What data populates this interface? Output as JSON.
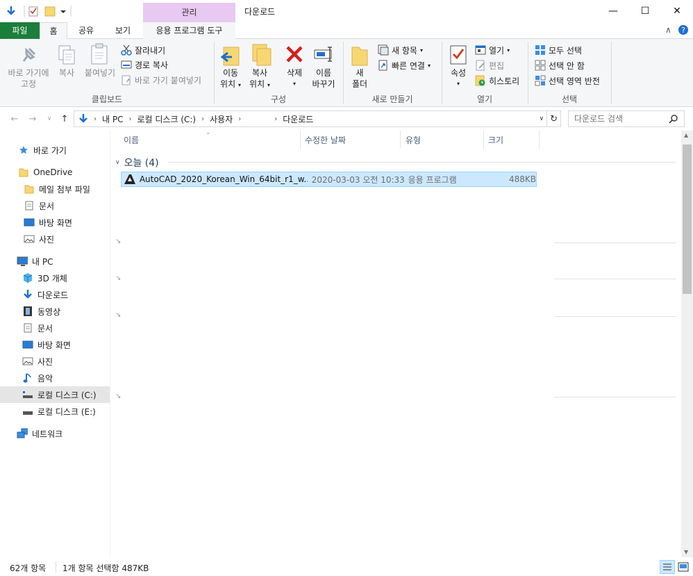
{
  "window": {
    "title": "다운로드",
    "context_tab": "관리",
    "controls": {
      "minimize": "—",
      "maximize": "☐",
      "close": "✕"
    }
  },
  "ribbon_tabs": {
    "file": "파일",
    "home": "홈",
    "share": "공유",
    "view": "보기",
    "app_tools": "응용 프로그램 도구"
  },
  "ribbon": {
    "clipboard": {
      "label": "클립보드",
      "pin_line1": "바로 가기에",
      "pin_line2": "고정",
      "copy": "복사",
      "paste": "붙여넣기",
      "cut": "잘라내기",
      "copy_path": "경로 복사",
      "paste_shortcut": "바로 가기 붙여넣기"
    },
    "organize": {
      "label": "구성",
      "move_line1": "이동",
      "move_line2": "위치",
      "copy_line1": "복사",
      "copy_line2": "위치",
      "delete": "삭제",
      "rename_line1": "이름",
      "rename_line2": "바꾸기"
    },
    "new": {
      "label": "새로 만들기",
      "folder_line1": "새",
      "folder_line2": "폴더",
      "new_item": "새 항목",
      "easy_access": "빠른 연결"
    },
    "open": {
      "label": "열기",
      "properties": "속성",
      "open": "열기",
      "edit": "편집",
      "history": "히스토리"
    },
    "select": {
      "label": "선택",
      "select_all": "모두 선택",
      "select_none": "선택 안 함",
      "invert": "선택 영역 반전"
    }
  },
  "address": {
    "crumbs": [
      "내 PC",
      "로컬 디스크 (C:)",
      "사용자",
      "다운로드"
    ],
    "search_placeholder": "다운로드 검색"
  },
  "nav": {
    "quick_access": "바로 가기",
    "onedrive": "OneDrive",
    "onedrive_items": [
      "메일 첨부 파일",
      "문서",
      "바탕 화면",
      "사진"
    ],
    "this_pc": "내 PC",
    "pc_items": [
      "3D 개체",
      "다운로드",
      "동영상",
      "문서",
      "바탕 화면",
      "사진",
      "음악",
      "로컬 디스크 (C:)",
      "로컬 디스크 (E:)"
    ],
    "network": "네트워크"
  },
  "columns": {
    "name": "이름",
    "modified": "수정한 날짜",
    "type": "유형",
    "size": "크기"
  },
  "groups": {
    "today": "오늘 (4)"
  },
  "files": [
    {
      "name": "AutoCAD_2020_Korean_Win_64bit_r1_w...",
      "modified": "2020-03-03 오전 10:33",
      "type": "응용 프로그램",
      "size": "488KB"
    }
  ],
  "status": {
    "count": "62개 항목",
    "selection": "1개 항목 선택함 487KB"
  },
  "colors": {
    "file_tab": "#1c7e3b",
    "context_tab": "#e8c9f1",
    "selection": "#cce8ff",
    "accent": "#0078d7"
  }
}
